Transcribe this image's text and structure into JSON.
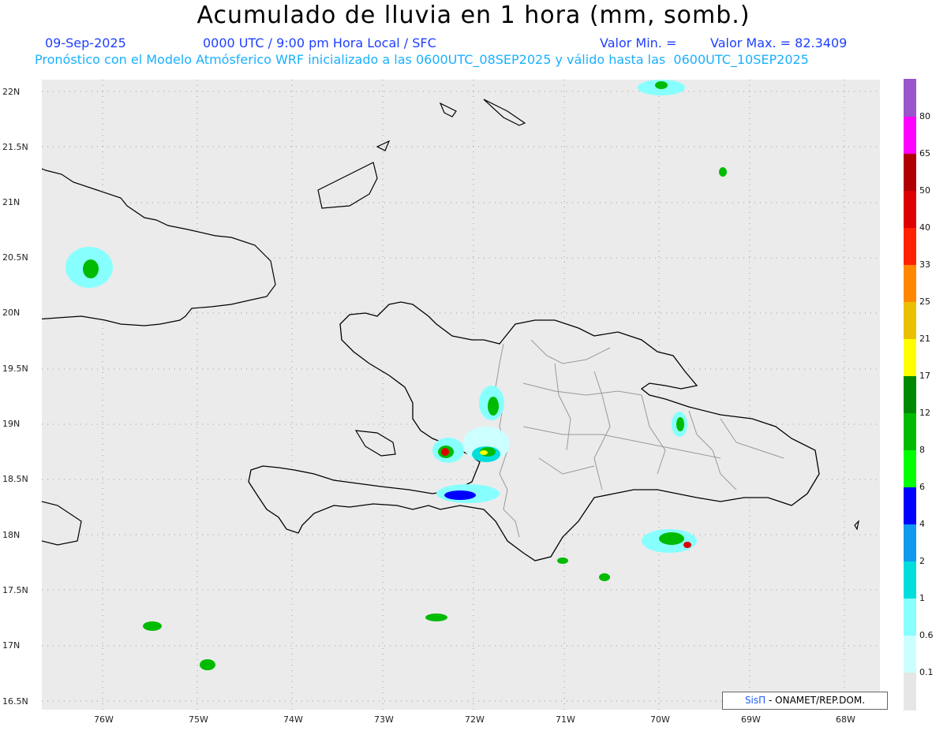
{
  "title": "Acumulado de lluvia en 1 hora (mm, somb.)",
  "header": {
    "date": "09-Sep-2025",
    "time": "0000 UTC / 9:00 pm Hora Local / SFC",
    "valor_min": "Valor Min. =",
    "valor_max": "Valor Max. = 82.3409",
    "model_line": "Pronóstico con el Modelo Atmósferico WRF inicializado a las 0600UTC_08SEP2025 y válido hasta las  0600UTC_10SEP2025"
  },
  "axes": {
    "lat_labels": [
      "22N",
      "21.5N",
      "21N",
      "20.5N",
      "20N",
      "19.5N",
      "19N",
      "18.5N",
      "18N",
      "17.5N",
      "17N",
      "16.5N"
    ],
    "lon_labels": [
      "76W",
      "75W",
      "74W",
      "73W",
      "72W",
      "71W",
      "70W",
      "69W",
      "68W"
    ]
  },
  "colorbar": {
    "labels": [
      "80",
      "65",
      "50",
      "40",
      "33",
      "25",
      "21",
      "17",
      "12",
      "8",
      "6",
      "4",
      "2",
      "1",
      "0.6",
      "0.1"
    ],
    "colors": [
      "#9955cc",
      "#ff00ff",
      "#b00000",
      "#dd0000",
      "#ff2200",
      "#ff8800",
      "#e8c000",
      "#ffff00",
      "#008800",
      "#00bb00",
      "#00ff00",
      "#0000ff",
      "#1199ee",
      "#00dddd",
      "#88ffff",
      "#ccffff",
      "#e6e6e6"
    ]
  },
  "credit": {
    "brand": "SisΠ",
    "text": "- ONAMET/REP.DOM."
  }
}
